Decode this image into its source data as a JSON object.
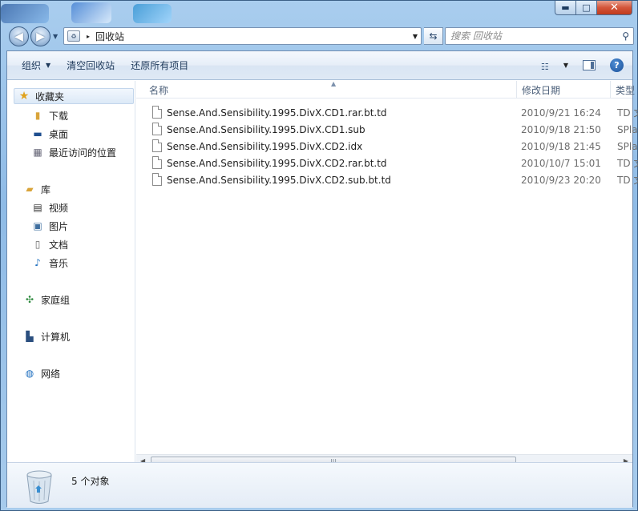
{
  "window": {
    "caption_buttons": {
      "minimize": "▬",
      "maximize": "□",
      "close": "✕"
    }
  },
  "address": {
    "breadcrumb_arrow": "▸",
    "path": "回收站"
  },
  "search": {
    "placeholder": "搜索 回收站"
  },
  "toolbar": {
    "organize": "组织",
    "empty_bin": "清空回收站",
    "restore_all": "还原所有项目"
  },
  "sidebar": {
    "favorites": {
      "header": "收藏夹",
      "items": [
        {
          "label": "下载",
          "icon": "downloads-folder-icon"
        },
        {
          "label": "桌面",
          "icon": "desktop-icon"
        },
        {
          "label": "最近访问的位置",
          "icon": "recent-places-icon"
        }
      ]
    },
    "libraries": {
      "header": "库",
      "items": [
        {
          "label": "视频",
          "icon": "videos-icon"
        },
        {
          "label": "图片",
          "icon": "pictures-icon"
        },
        {
          "label": "文档",
          "icon": "documents-icon"
        },
        {
          "label": "音乐",
          "icon": "music-icon"
        }
      ]
    },
    "homegroup": "家庭组",
    "computer": "计算机",
    "network": "网络"
  },
  "columns": {
    "name": "名称",
    "date_modified": "修改日期",
    "type": "类型"
  },
  "files": [
    {
      "name": "Sense.And.Sensibility.1995.DivX.CD1.rar.bt.td",
      "date": "2010/9/21 16:24",
      "type": "TD 文"
    },
    {
      "name": "Sense.And.Sensibility.1995.DivX.CD1.sub",
      "date": "2010/9/18 21:50",
      "type": "SPla"
    },
    {
      "name": "Sense.And.Sensibility.1995.DivX.CD2.idx",
      "date": "2010/9/18 21:45",
      "type": "SPla"
    },
    {
      "name": "Sense.And.Sensibility.1995.DivX.CD2.rar.bt.td",
      "date": "2010/10/7 15:01",
      "type": "TD 文"
    },
    {
      "name": "Sense.And.Sensibility.1995.DivX.CD2.sub.bt.td",
      "date": "2010/9/23 20:20",
      "type": "TD 文"
    }
  ],
  "details": {
    "count": "5 个对象"
  },
  "colors": {
    "accent": "#1e395b",
    "selection": "#dce9f7"
  }
}
